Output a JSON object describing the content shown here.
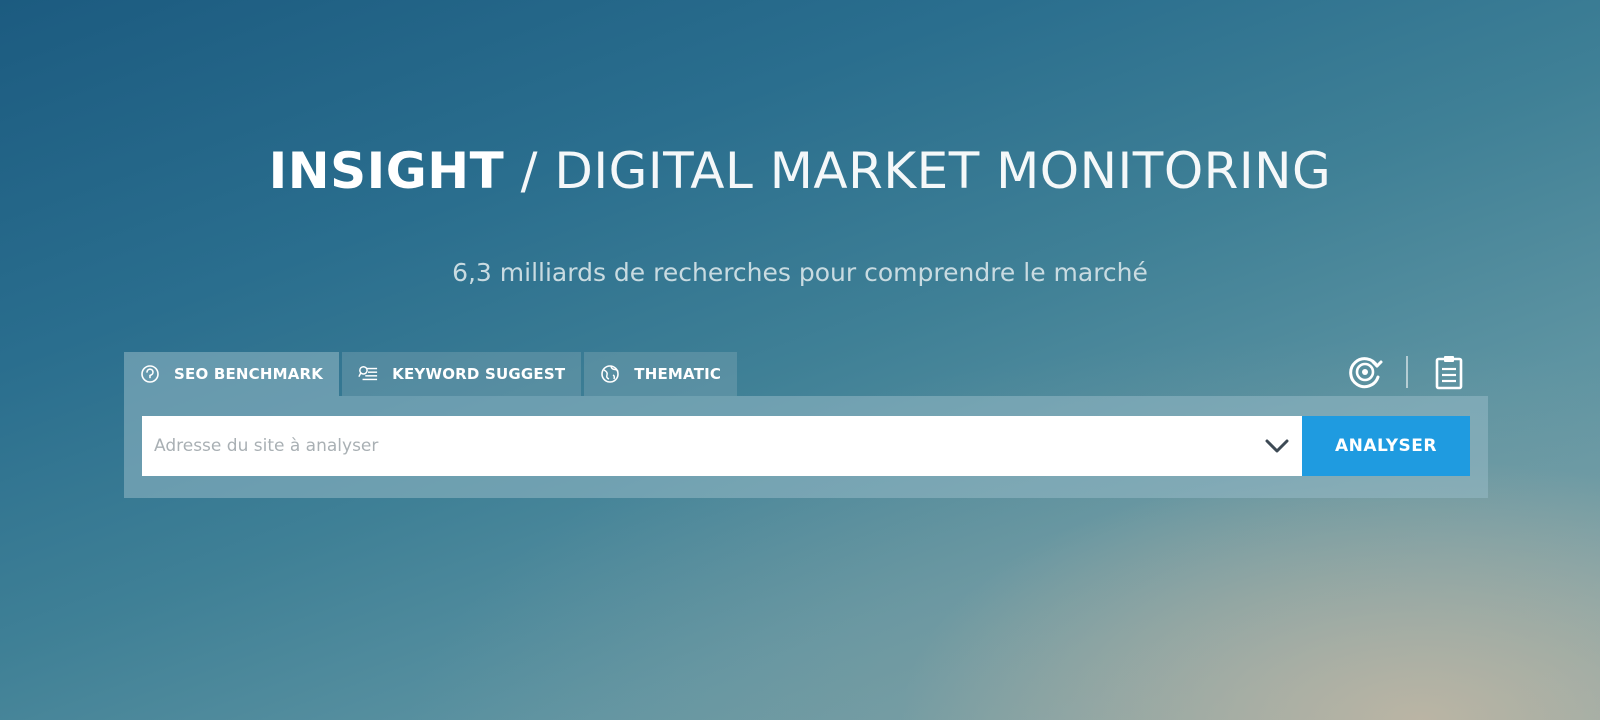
{
  "header": {
    "brand": "INSIGHT",
    "separator": " / ",
    "tagline": "DIGITAL MARKET MONITORING",
    "subtitle": "6,3 milliards de recherches pour comprendre le marché"
  },
  "tabs": [
    {
      "label": "SEO BENCHMARK",
      "icon": "gauge-icon",
      "active": true
    },
    {
      "label": "KEYWORD SUGGEST",
      "icon": "keyword-list-icon",
      "active": false
    },
    {
      "label": "THEMATIC",
      "icon": "globe-icon",
      "active": false
    }
  ],
  "tools": [
    {
      "icon": "target-refresh-icon"
    },
    {
      "icon": "clipboard-icon"
    }
  ],
  "search": {
    "placeholder": "Adresse du site à analyser",
    "value": "",
    "button_label": "ANALYSER"
  },
  "colors": {
    "accent": "#1f9be0",
    "panel": "#96b9c6",
    "background_top": "#1c5b80"
  }
}
